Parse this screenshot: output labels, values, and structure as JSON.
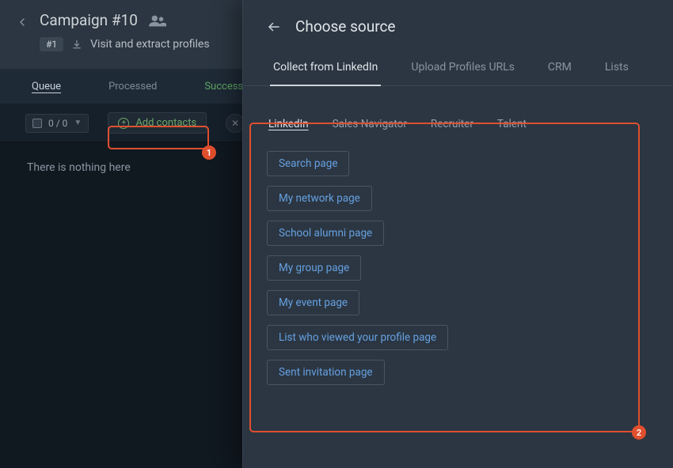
{
  "header": {
    "campaign_title": "Campaign #10",
    "step_chip": "#1",
    "step_text": "Visit and extract profiles"
  },
  "tabs": {
    "queue": "Queue",
    "processed": "Processed",
    "successful": "Successful"
  },
  "toolbar": {
    "count": "0 / 0",
    "add_contacts": "Add contacts"
  },
  "content": {
    "empty": "There is nothing here"
  },
  "callouts": {
    "one": "1",
    "two": "2"
  },
  "panel": {
    "title": "Choose source",
    "source_tabs": {
      "collect": "Collect from LinkedIn",
      "upload": "Upload Profiles URLs",
      "crm": "CRM",
      "lists": "Lists"
    },
    "sub_tabs": {
      "linkedin": "LinkedIn",
      "sales_navigator": "Sales Navigator",
      "recruiter": "Recruiter",
      "talent": "Talent"
    },
    "options": {
      "search_page": "Search page",
      "my_network": "My network page",
      "school_alumni": "School alumni page",
      "my_group": "My group page",
      "my_event": "My event page",
      "viewed_profile": "List who viewed your profile page",
      "sent_invitation": "Sent invitation page"
    }
  }
}
